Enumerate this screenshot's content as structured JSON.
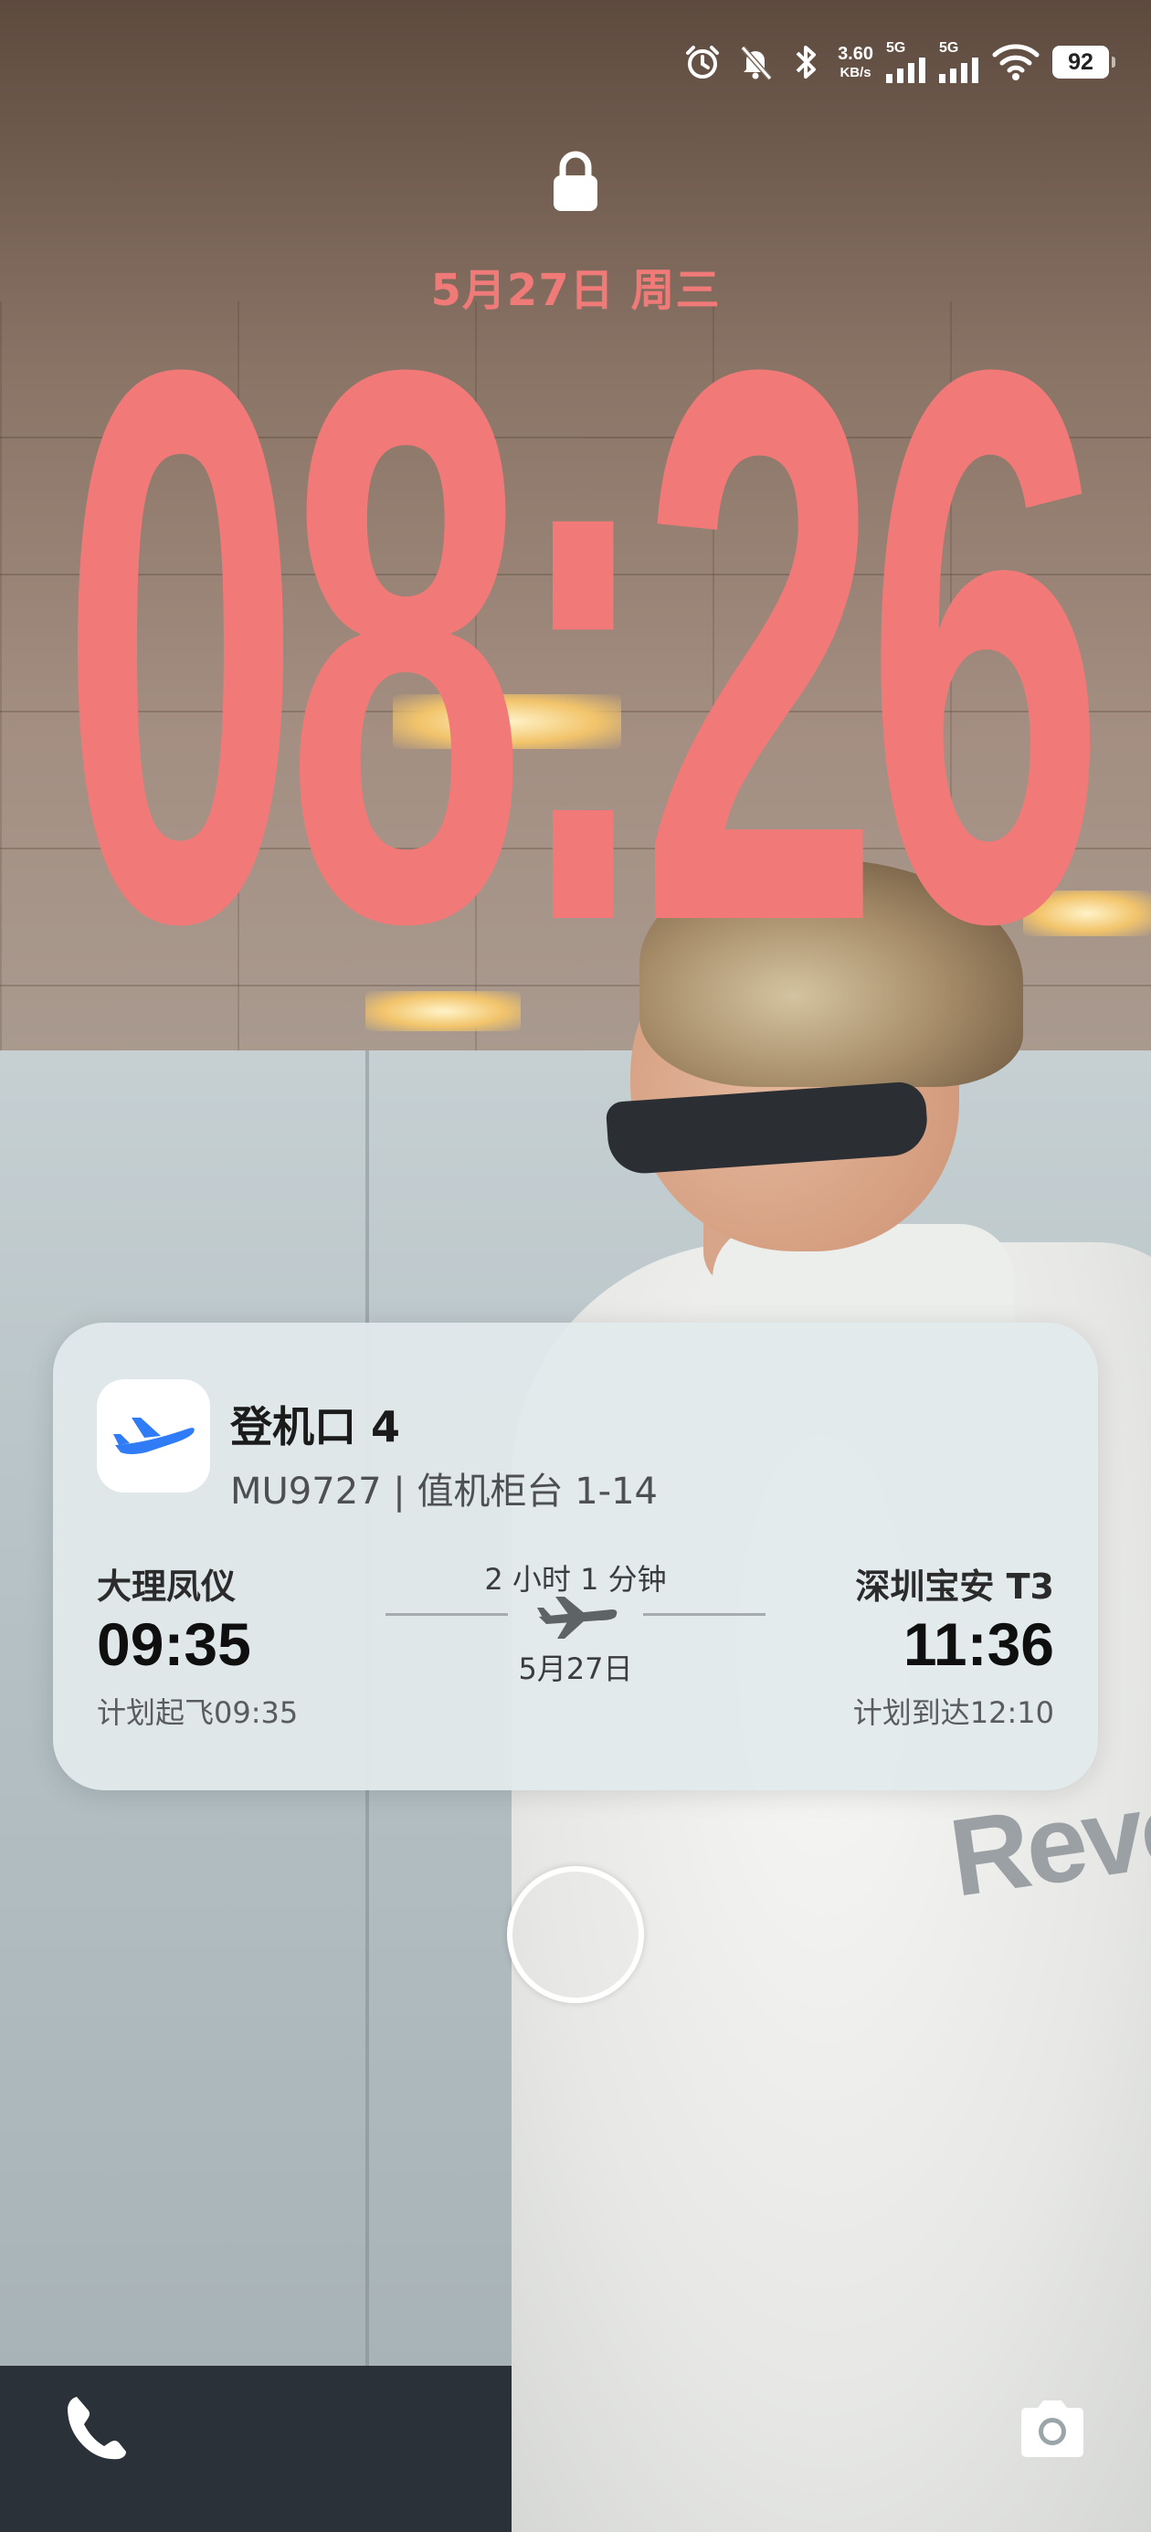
{
  "status_bar": {
    "net_speed_value": "3.60",
    "net_speed_unit": "KB/s",
    "sim1_type": "5G",
    "sim2_type": "5G",
    "battery_level": "92",
    "icons": [
      "alarm-icon",
      "mute-bell-icon",
      "bluetooth-icon",
      "signal-icon",
      "signal-icon",
      "wifi-icon",
      "battery-icon"
    ]
  },
  "lockscreen": {
    "date": "5月27日 周三",
    "time": "08:26",
    "clock_color": "#f17a78"
  },
  "flight_card": {
    "gate": "登机口 4",
    "flight_info": "MU9727 | 值机柜台 1-14",
    "departure": {
      "city": "大理凤仪",
      "time": "09:35",
      "planned": "计划起飞09:35"
    },
    "arrival": {
      "city": "深圳宝安 T3",
      "time": "11:36",
      "planned": "计划到达12:10"
    },
    "duration": "2 小时 1 分钟",
    "date": "5月27日",
    "app_icon": "airplane-icon",
    "accent": "#2f7cf6"
  },
  "bottom": {
    "left_icon": "phone-icon",
    "right_icon": "camera-icon"
  }
}
